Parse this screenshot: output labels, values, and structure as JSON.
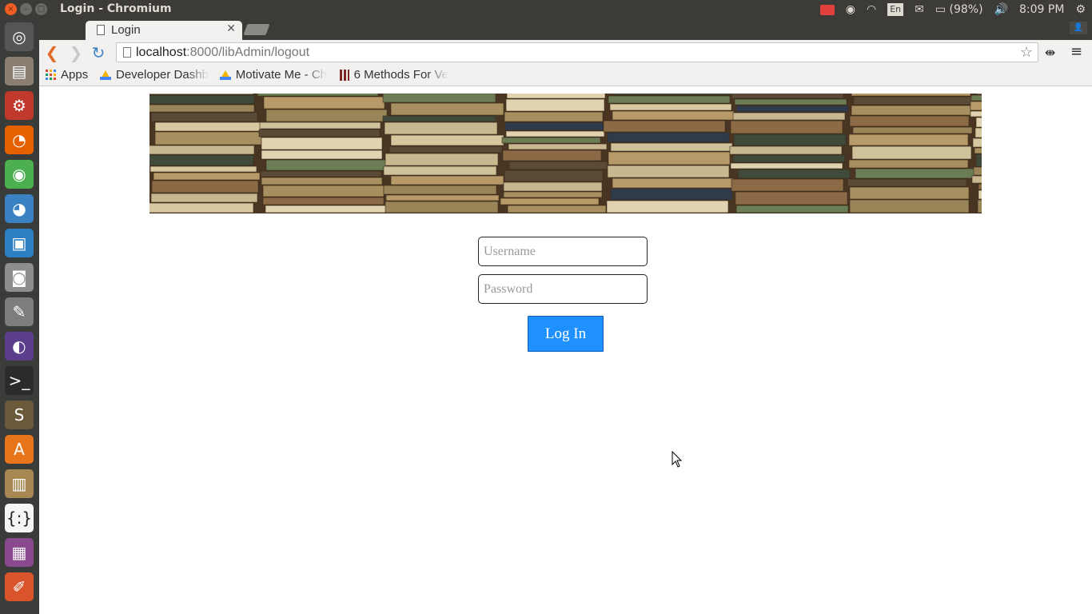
{
  "window": {
    "title": "Login - Chromium"
  },
  "system": {
    "battery": "(98%)",
    "time": "8:09 PM",
    "lang": "En"
  },
  "tab": {
    "title": "Login"
  },
  "address": {
    "host": "localhost",
    "rest": ":8000/libAdmin/logout"
  },
  "bookmarks": [
    {
      "label": "Apps"
    },
    {
      "label": "Developer Dashb"
    },
    {
      "label": "Motivate Me - Ch"
    },
    {
      "label": "6 Methods For Ve"
    }
  ],
  "form": {
    "username_placeholder": "Username",
    "password_placeholder": "Password",
    "login_label": "Log In"
  },
  "colors": {
    "login_button": "#1e90ff",
    "back_arrow": "#e06c2c",
    "reload": "#3e84c8"
  },
  "launcher": [
    {
      "icon": "ubuntu-dash-icon"
    },
    {
      "icon": "files-icon"
    },
    {
      "icon": "settings-icon"
    },
    {
      "icon": "firefox-icon"
    },
    {
      "icon": "chrome-icon"
    },
    {
      "icon": "chromium-icon"
    },
    {
      "icon": "box-icon"
    },
    {
      "icon": "camera-icon"
    },
    {
      "icon": "text-editor-icon"
    },
    {
      "icon": "eclipse-icon"
    },
    {
      "icon": "terminal-icon"
    },
    {
      "icon": "sublime-icon"
    },
    {
      "icon": "software-center-icon"
    },
    {
      "icon": "archive-icon"
    },
    {
      "icon": "brackets-icon"
    },
    {
      "icon": "media-icon"
    },
    {
      "icon": "tool-icon"
    }
  ]
}
